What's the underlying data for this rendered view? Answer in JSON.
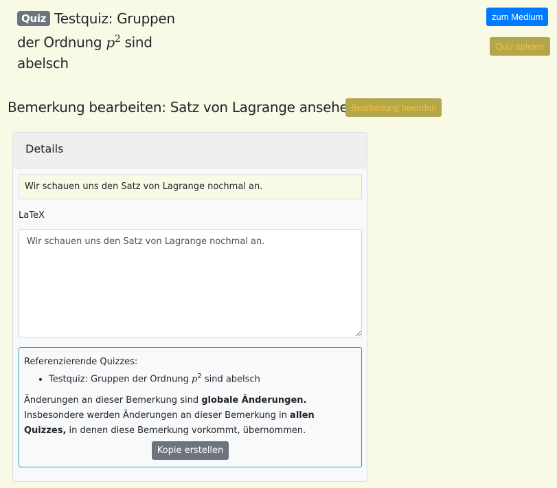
{
  "header": {
    "badge": "Quiz",
    "title_pre": "Testquiz: Gruppen der Ordnung ",
    "title_math": "p",
    "title_sup": "2",
    "title_post": " sind abelsch"
  },
  "buttons": {
    "medium": "zum Medium",
    "play": "Quiz spielen",
    "end_edit": "Bearbeitung beenden",
    "copy": "Kopie erstellen"
  },
  "page_heading": "Bemerkung bearbeiten: Satz von Lagrange ansehen",
  "card": {
    "title": "Details",
    "preview": "Wir schauen uns den Satz von Lagrange nochmal an.",
    "latex_label": "LaTeX",
    "latex_value": "Wir schauen uns den Satz von Lagrange nochmal an.",
    "ref_label": "Referenzierende Quizzes:",
    "ref_items": [
      {
        "pre": "Testquiz: Gruppen der Ordnung ",
        "math": "p",
        "sup": "2",
        "post": " sind abelsch"
      }
    ],
    "notice": {
      "t1": "Änderungen an dieser Bemerkung sind ",
      "b1": "globale Änderungen.",
      "t2": " Insbesondere werden Änderungen an dieser Bemerkung in ",
      "b2": "allen Quizzes,",
      "t3": " in denen diese Bemerkung vorkommt, übernommen."
    }
  }
}
